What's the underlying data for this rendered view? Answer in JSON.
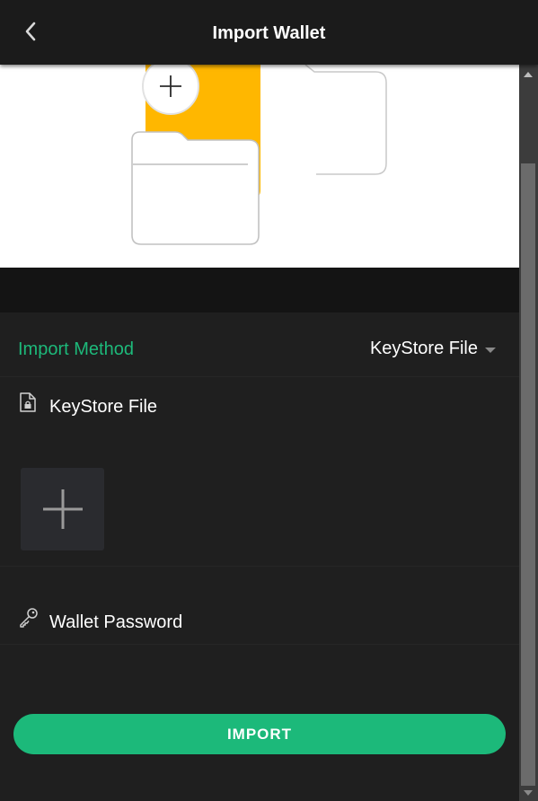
{
  "header": {
    "title": "Import Wallet",
    "back_icon": "chevron-left-icon"
  },
  "import_method": {
    "label": "Import Method",
    "selected": "KeyStore File"
  },
  "keystore": {
    "label": "KeyStore File",
    "icon": "locked-file-icon",
    "upload_icon": "plus-icon"
  },
  "password": {
    "label": "Wallet Password",
    "icon": "key-icon"
  },
  "actions": {
    "import_label": "IMPORT"
  },
  "colors": {
    "accent": "#1cb97a",
    "background": "#1f1f1f",
    "folder_yellow": "#ffb700"
  }
}
